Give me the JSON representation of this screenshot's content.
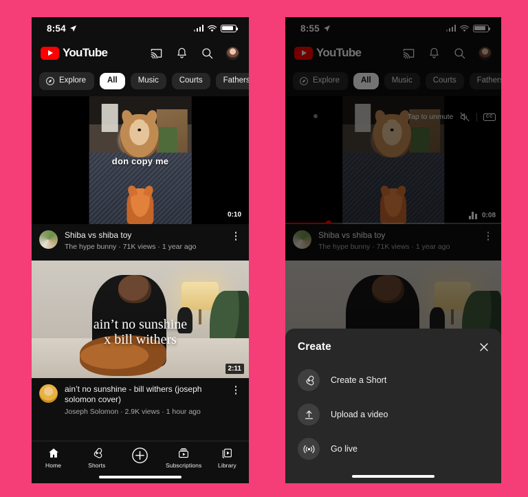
{
  "background_color": "#F53D77",
  "left_phone": {
    "status_bar": {
      "time": "8:54",
      "icons": [
        "location-arrow",
        "cellular-bars",
        "wifi",
        "battery"
      ]
    },
    "app_bar": {
      "brand": "YouTube",
      "actions": [
        "cast-icon",
        "notifications-bell-icon",
        "search-icon",
        "account-avatar"
      ]
    },
    "chips": [
      {
        "label": "Explore",
        "icon": "compass-icon",
        "active": false
      },
      {
        "label": "All",
        "active": true
      },
      {
        "label": "Music",
        "active": false
      },
      {
        "label": "Courts",
        "active": false
      },
      {
        "label": "Fathers",
        "active": false
      }
    ],
    "videos": [
      {
        "caption_overlay": "don copy me",
        "duration": "0:10",
        "title": "Shiba vs shiba toy",
        "channel": "The hype bunny",
        "views": "71K views",
        "age": "1 year ago",
        "meta_line": "The hype bunny · 71K views · 1 year ago"
      },
      {
        "caption_overlay_line1": "ain’t no sunshine",
        "caption_overlay_line2": "x bill withers",
        "duration": "2:11",
        "title": "ain’t no sunshine - bill withers (joseph solomon cover)",
        "channel": "Joseph Solomon",
        "views": "2.9K views",
        "age": "1 hour ago",
        "meta_line": "Joseph Solomon · 2.9K views · 1 hour ago"
      }
    ],
    "bottom_nav": [
      {
        "label": "Home",
        "icon": "home-icon",
        "active": true
      },
      {
        "label": "Shorts",
        "icon": "shorts-icon",
        "active": false
      },
      {
        "label": "",
        "icon": "create-plus-icon",
        "active": false
      },
      {
        "label": "Subscriptions",
        "icon": "subscriptions-icon",
        "active": false
      },
      {
        "label": "Library",
        "icon": "library-icon",
        "active": false
      }
    ]
  },
  "right_phone": {
    "status_bar": {
      "time": "8:55"
    },
    "app_bar": {
      "brand": "YouTube"
    },
    "chips": [
      {
        "label": "Explore",
        "icon": "compass-icon",
        "active": false
      },
      {
        "label": "All",
        "active": true
      },
      {
        "label": "Music",
        "active": false
      },
      {
        "label": "Courts",
        "active": false
      },
      {
        "label": "Fathers",
        "active": false
      }
    ],
    "player": {
      "unmute_label": "Tap to unmute",
      "mute_icon": "muted-speaker-icon",
      "cc_label": "CC",
      "duration": "0:08",
      "progress_percent": 20
    },
    "video_meta": {
      "title": "Shiba vs shiba toy",
      "meta_line": "The hype bunny · 71K views · 1 year ago"
    },
    "create_sheet": {
      "title": "Create",
      "close_icon": "close-x-icon",
      "items": [
        {
          "label": "Create a Short",
          "icon": "shorts-icon"
        },
        {
          "label": "Upload a video",
          "icon": "upload-arrow-icon"
        },
        {
          "label": "Go live",
          "icon": "broadcast-icon"
        }
      ]
    }
  }
}
